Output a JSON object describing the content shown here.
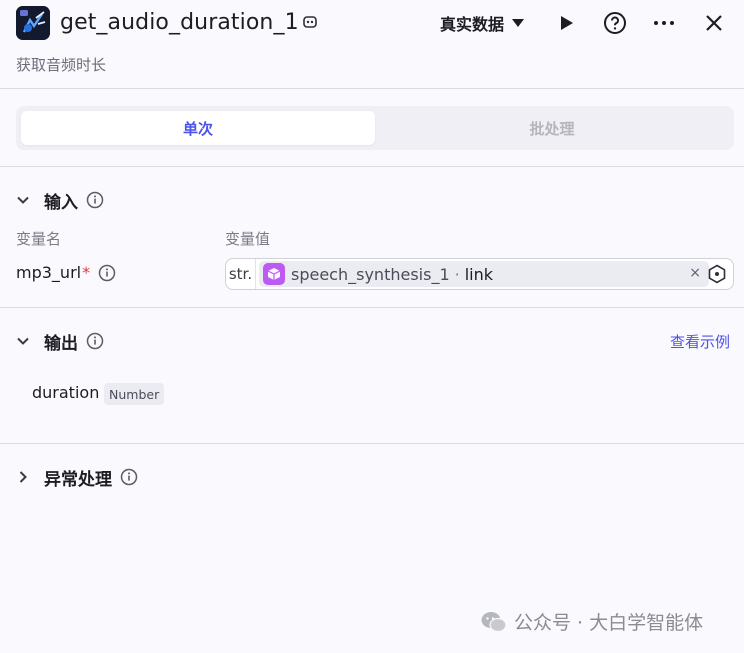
{
  "header": {
    "title": "get_audio_duration_1",
    "subtitle": "获取音频时长",
    "mode_label": "真实数据",
    "icons": [
      "edit-icon",
      "play-icon",
      "help-icon",
      "more-icon",
      "close-icon"
    ]
  },
  "tabs": [
    {
      "label": "单次",
      "active": true
    },
    {
      "label": "批处理",
      "active": false
    }
  ],
  "input_section": {
    "title": "输入",
    "col_name": "变量名",
    "col_value": "变量值",
    "variable": {
      "name": "mp3_url",
      "required_mark": "*",
      "type_tag": "str.",
      "ref_node": "speech_synthesis_1",
      "ref_sep": "·",
      "ref_field": "link",
      "clear_glyph": "×"
    }
  },
  "output_section": {
    "title": "输出",
    "example_link": "查看示例",
    "field_name": "duration",
    "field_type": "Number"
  },
  "exception_section": {
    "title": "异常处理"
  },
  "watermark": "公众号 · 大白学智能体",
  "colors": {
    "accent": "#4d53e8",
    "required": "#e5383b",
    "ref_icon": "#bd5af2",
    "background": "#faf9fd"
  }
}
